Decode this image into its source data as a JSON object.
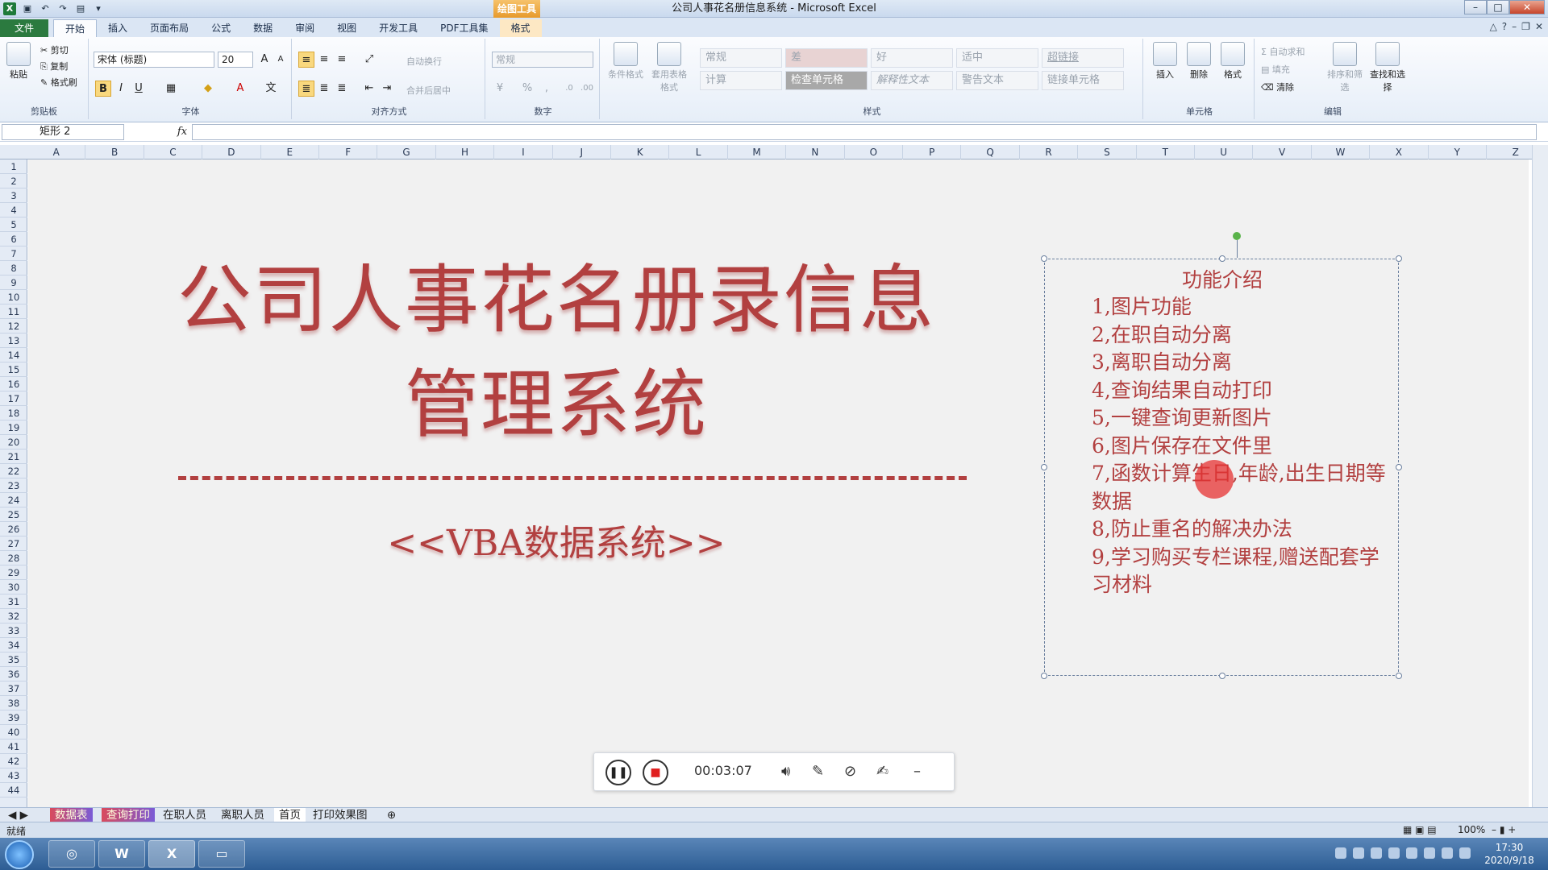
{
  "window": {
    "title": "公司人事花名册信息系统 - Microsoft Excel",
    "context_group": "绘图工具"
  },
  "tabs": [
    {
      "label": "文件"
    },
    {
      "label": "开始"
    },
    {
      "label": "插入"
    },
    {
      "label": "页面布局"
    },
    {
      "label": "公式"
    },
    {
      "label": "数据"
    },
    {
      "label": "审阅"
    },
    {
      "label": "视图"
    },
    {
      "label": "开发工具"
    },
    {
      "label": "PDF工具集"
    },
    {
      "label": "格式"
    }
  ],
  "ribbon": {
    "clipboard": {
      "paste": "粘贴",
      "cut": "剪切",
      "copy": "复制",
      "format_painter": "格式刷",
      "label": "剪贴板"
    },
    "font": {
      "name": "宋体 (标题)",
      "size": "20",
      "label": "字体"
    },
    "alignment": {
      "wrap": "自动换行",
      "merge": "合并后居中",
      "label": "对齐方式"
    },
    "number": {
      "format": "常规",
      "label": "数字"
    },
    "styles": {
      "conditional": "条件格式",
      "as_table": "套用表格格式",
      "cells": [
        "常规",
        "差",
        "好",
        "适中",
        "超链接",
        "计算",
        "检查单元格",
        "解释性文本",
        "警告文本",
        "链接单元格"
      ],
      "label": "样式"
    },
    "cells": {
      "insert": "插入",
      "delete": "删除",
      "format": "格式",
      "label": "单元格"
    },
    "editing": {
      "autosum": "自动求和",
      "fill": "填充",
      "clear": "清除",
      "sort": "排序和筛选",
      "find": "查找和选择",
      "label": "编辑"
    }
  },
  "formula": {
    "name_box": "矩形 2",
    "fx": "fx",
    "value": ""
  },
  "columns": [
    "A",
    "B",
    "C",
    "D",
    "E",
    "F",
    "G",
    "H",
    "I",
    "J",
    "K",
    "L",
    "M",
    "N",
    "O",
    "P",
    "Q",
    "R",
    "S",
    "T",
    "U",
    "V",
    "W",
    "X",
    "Y",
    "Z"
  ],
  "rows": [
    "1",
    "2",
    "3",
    "4",
    "5",
    "6",
    "7",
    "8",
    "9",
    "10",
    "11",
    "12",
    "13",
    "14",
    "15",
    "16",
    "17",
    "18",
    "19",
    "20",
    "21",
    "22",
    "23",
    "24",
    "25",
    "26",
    "27",
    "28",
    "29",
    "30",
    "31",
    "32",
    "33",
    "34",
    "35",
    "36",
    "37",
    "38",
    "39",
    "40",
    "41",
    "42",
    "43",
    "44"
  ],
  "sheet": {
    "title_line1": "公司人事花名册录信息",
    "title_line2": "管理系统",
    "subtitle": "<<VBA数据系统>>",
    "textbox": {
      "title": "功能介绍",
      "items": [
        "1,图片功能",
        "2,在职自动分离",
        "3,离职自动分离",
        "4,查询结果自动打印",
        "5,一键查询更新图片",
        "6,图片保存在文件里",
        "7,函数计算生日,年龄,出生日期等数据",
        "8,防止重名的解决办法",
        "9,学习购买专栏课程,赠送配套学习材料"
      ]
    }
  },
  "recorder": {
    "time": "00:03:07"
  },
  "sheet_tabs": [
    "数据表",
    "查询打印",
    "在职人员",
    "离职人员",
    "首页",
    "打印效果图"
  ],
  "status": {
    "ready": "就绪",
    "zoom": "100%"
  },
  "taskbar": {
    "time": "17:30",
    "date": "2020/9/18"
  }
}
